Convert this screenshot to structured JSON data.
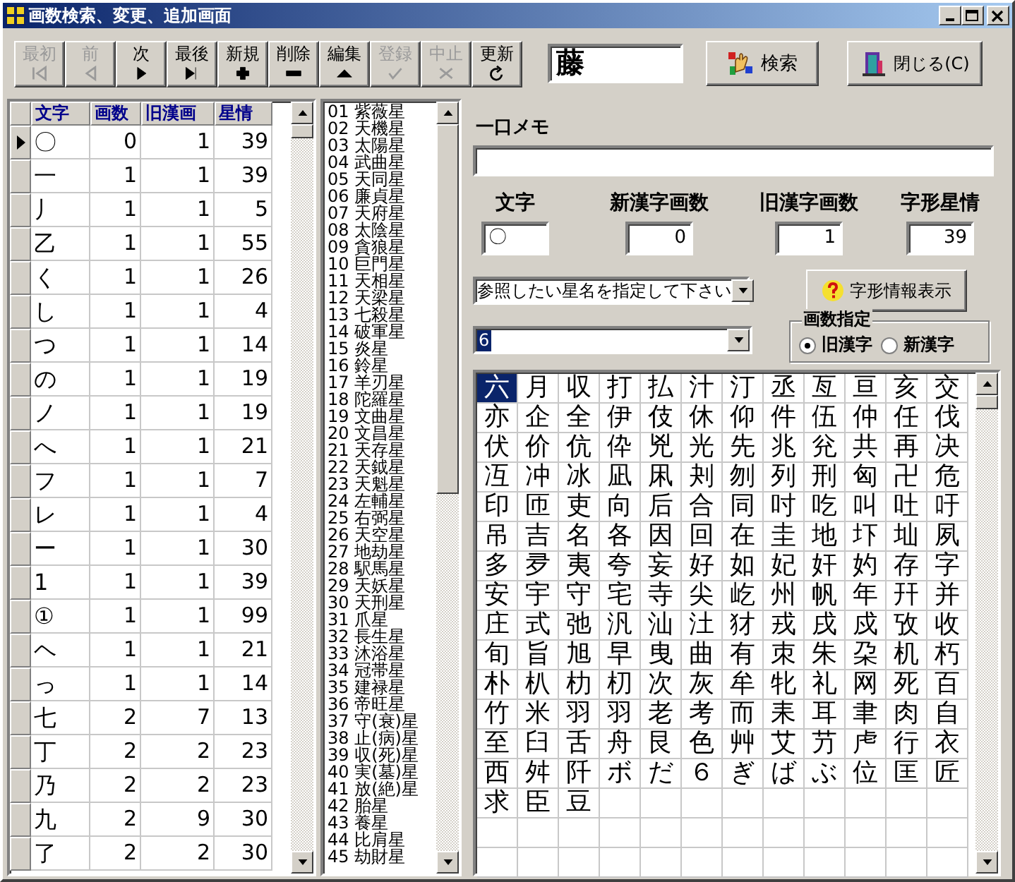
{
  "window": {
    "title": "画数検索、変更、追加画面"
  },
  "toolbar": {
    "buttons": [
      {
        "label": "最初",
        "kind": "first",
        "disabled": true
      },
      {
        "label": "前",
        "kind": "prev",
        "disabled": true
      },
      {
        "label": "次",
        "kind": "next",
        "disabled": false
      },
      {
        "label": "最後",
        "kind": "last",
        "disabled": false
      },
      {
        "label": "新規",
        "kind": "add",
        "disabled": false
      },
      {
        "label": "削除",
        "kind": "delete",
        "disabled": false
      },
      {
        "label": "編集",
        "kind": "edit",
        "disabled": false
      },
      {
        "label": "登録",
        "kind": "check",
        "disabled": true
      },
      {
        "label": "中止",
        "kind": "cancel",
        "disabled": true
      },
      {
        "label": "更新",
        "kind": "refresh",
        "disabled": false
      }
    ],
    "search_field": {
      "value": "藤"
    },
    "search_button": "検索",
    "close_button": "閉じる(C)"
  },
  "char_table": {
    "columns": [
      "文字",
      "画数",
      "旧漢画",
      "星情"
    ],
    "rows": [
      {
        "cells": [
          "〇",
          "0",
          "1",
          "39"
        ],
        "selected": true
      },
      {
        "cells": [
          "一",
          "1",
          "1",
          "39"
        ],
        "selected": false
      },
      {
        "cells": [
          "丿",
          "1",
          "1",
          "5"
        ],
        "selected": false
      },
      {
        "cells": [
          "乙",
          "1",
          "1",
          "55"
        ],
        "selected": false
      },
      {
        "cells": [
          "く",
          "1",
          "1",
          "26"
        ],
        "selected": false
      },
      {
        "cells": [
          "し",
          "1",
          "1",
          "4"
        ],
        "selected": false
      },
      {
        "cells": [
          "つ",
          "1",
          "1",
          "14"
        ],
        "selected": false
      },
      {
        "cells": [
          "の",
          "1",
          "1",
          "19"
        ],
        "selected": false
      },
      {
        "cells": [
          "ノ",
          "1",
          "1",
          "19"
        ],
        "selected": false
      },
      {
        "cells": [
          "へ",
          "1",
          "1",
          "21"
        ],
        "selected": false
      },
      {
        "cells": [
          "フ",
          "1",
          "1",
          "7"
        ],
        "selected": false
      },
      {
        "cells": [
          "レ",
          "1",
          "1",
          "4"
        ],
        "selected": false
      },
      {
        "cells": [
          "ー",
          "1",
          "1",
          "30"
        ],
        "selected": false
      },
      {
        "cells": [
          "1",
          "1",
          "1",
          "39"
        ],
        "selected": false
      },
      {
        "cells": [
          "①",
          "1",
          "1",
          "99"
        ],
        "selected": false
      },
      {
        "cells": [
          "ヘ",
          "1",
          "1",
          "21"
        ],
        "selected": false
      },
      {
        "cells": [
          "っ",
          "1",
          "1",
          "14"
        ],
        "selected": false
      },
      {
        "cells": [
          "七",
          "2",
          "7",
          "13"
        ],
        "selected": false
      },
      {
        "cells": [
          "丁",
          "2",
          "2",
          "23"
        ],
        "selected": false
      },
      {
        "cells": [
          "乃",
          "2",
          "2",
          "23"
        ],
        "selected": false
      },
      {
        "cells": [
          "九",
          "2",
          "9",
          "30"
        ],
        "selected": false
      },
      {
        "cells": [
          "了",
          "2",
          "2",
          "30"
        ],
        "selected": false
      }
    ]
  },
  "star_list": {
    "items": [
      "01 紫薇星",
      "02 天機星",
      "03 太陽星",
      "04 武曲星",
      "05 天同星",
      "06 廉貞星",
      "07 天府星",
      "08 太陰星",
      "09 貪狼星",
      "10 巨門星",
      "11 天相星",
      "12 天梁星",
      "13 七殺星",
      "14 破軍星",
      "15 炎星",
      "16 鈴星",
      "17 羊刃星",
      "18 陀羅星",
      "19 文曲星",
      "20 文昌星",
      "21 天存星",
      "22 天鉞星",
      "23 天魁星",
      "24 左輔星",
      "25 右弼星",
      "26 天空星",
      "27 地劫星",
      "28 駅馬星",
      "29 天妖星",
      "30 天刑星",
      "31 爪星",
      "32 長生星",
      "33 沐浴星",
      "34 冠帯星",
      "35 建禄星",
      "36 帝旺星",
      "37 守(衰)星",
      "38 止(病)星",
      "39 収(死)星",
      "40 実(墓)星",
      "41 放(絶)星",
      "42 胎星",
      "43 養星",
      "44 比肩星",
      "45 劫財星"
    ]
  },
  "detail": {
    "memo_label": "一口メモ",
    "fields": [
      {
        "label": "文字",
        "value": "〇",
        "kind": "text"
      },
      {
        "label": "新漢字画数",
        "value": "0",
        "kind": "number"
      },
      {
        "label": "旧漢字画数",
        "value": "1",
        "kind": "number"
      },
      {
        "label": "字形星情",
        "value": "39",
        "kind": "number"
      }
    ],
    "star_dropdown": {
      "value": "参照したい星名を指定して下さい"
    },
    "info_button": "字形情報表示",
    "count_dropdown": {
      "value": "6",
      "text_selected": true
    },
    "stroke_mode": {
      "title": "画数指定",
      "options": [
        {
          "label": "旧漢字",
          "selected": true
        },
        {
          "label": "新漢字",
          "selected": false
        }
      ]
    }
  },
  "char_grid": {
    "cells": [
      {
        "char": "六",
        "selected": true
      },
      {
        "char": "月",
        "selected": false
      },
      {
        "char": "収",
        "selected": false
      },
      {
        "char": "打",
        "selected": false
      },
      {
        "char": "払",
        "selected": false
      },
      {
        "char": "汁",
        "selected": false
      },
      {
        "char": "汀",
        "selected": false
      },
      {
        "char": "丞",
        "selected": false
      },
      {
        "char": "亙",
        "selected": false
      },
      {
        "char": "亘",
        "selected": false
      },
      {
        "char": "亥",
        "selected": false
      },
      {
        "char": "交",
        "selected": false
      },
      {
        "char": "亦",
        "selected": false
      },
      {
        "char": "企",
        "selected": false
      },
      {
        "char": "全",
        "selected": false
      },
      {
        "char": "伊",
        "selected": false
      },
      {
        "char": "伎",
        "selected": false
      },
      {
        "char": "休",
        "selected": false
      },
      {
        "char": "仰",
        "selected": false
      },
      {
        "char": "件",
        "selected": false
      },
      {
        "char": "伍",
        "selected": false
      },
      {
        "char": "仲",
        "selected": false
      },
      {
        "char": "任",
        "selected": false
      },
      {
        "char": "伐",
        "selected": false
      },
      {
        "char": "伏",
        "selected": false
      },
      {
        "char": "价",
        "selected": false
      },
      {
        "char": "伉",
        "selected": false
      },
      {
        "char": "伜",
        "selected": false
      },
      {
        "char": "兇",
        "selected": false
      },
      {
        "char": "光",
        "selected": false
      },
      {
        "char": "先",
        "selected": false
      },
      {
        "char": "兆",
        "selected": false
      },
      {
        "char": "兊",
        "selected": false
      },
      {
        "char": "共",
        "selected": false
      },
      {
        "char": "再",
        "selected": false
      },
      {
        "char": "决",
        "selected": false
      },
      {
        "char": "冱",
        "selected": false
      },
      {
        "char": "冲",
        "selected": false
      },
      {
        "char": "冰",
        "selected": false
      },
      {
        "char": "凪",
        "selected": false
      },
      {
        "char": "凩",
        "selected": false
      },
      {
        "char": "刔",
        "selected": false
      },
      {
        "char": "刎",
        "selected": false
      },
      {
        "char": "列",
        "selected": false
      },
      {
        "char": "刑",
        "selected": false
      },
      {
        "char": "匈",
        "selected": false
      },
      {
        "char": "卍",
        "selected": false
      },
      {
        "char": "危",
        "selected": false
      },
      {
        "char": "印",
        "selected": false
      },
      {
        "char": "匝",
        "selected": false
      },
      {
        "char": "吏",
        "selected": false
      },
      {
        "char": "向",
        "selected": false
      },
      {
        "char": "后",
        "selected": false
      },
      {
        "char": "合",
        "selected": false
      },
      {
        "char": "同",
        "selected": false
      },
      {
        "char": "吋",
        "selected": false
      },
      {
        "char": "吃",
        "selected": false
      },
      {
        "char": "叫",
        "selected": false
      },
      {
        "char": "吐",
        "selected": false
      },
      {
        "char": "吁",
        "selected": false
      },
      {
        "char": "吊",
        "selected": false
      },
      {
        "char": "吉",
        "selected": false
      },
      {
        "char": "名",
        "selected": false
      },
      {
        "char": "各",
        "selected": false
      },
      {
        "char": "因",
        "selected": false
      },
      {
        "char": "回",
        "selected": false
      },
      {
        "char": "在",
        "selected": false
      },
      {
        "char": "圭",
        "selected": false
      },
      {
        "char": "地",
        "selected": false
      },
      {
        "char": "圷",
        "selected": false
      },
      {
        "char": "圸",
        "selected": false
      },
      {
        "char": "夙",
        "selected": false
      },
      {
        "char": "多",
        "selected": false
      },
      {
        "char": "夛",
        "selected": false
      },
      {
        "char": "夷",
        "selected": false
      },
      {
        "char": "夸",
        "selected": false
      },
      {
        "char": "妄",
        "selected": false
      },
      {
        "char": "好",
        "selected": false
      },
      {
        "char": "如",
        "selected": false
      },
      {
        "char": "妃",
        "selected": false
      },
      {
        "char": "奸",
        "selected": false
      },
      {
        "char": "妁",
        "selected": false
      },
      {
        "char": "存",
        "selected": false
      },
      {
        "char": "字",
        "selected": false
      },
      {
        "char": "安",
        "selected": false
      },
      {
        "char": "宇",
        "selected": false
      },
      {
        "char": "守",
        "selected": false
      },
      {
        "char": "宅",
        "selected": false
      },
      {
        "char": "寺",
        "selected": false
      },
      {
        "char": "尖",
        "selected": false
      },
      {
        "char": "屹",
        "selected": false
      },
      {
        "char": "州",
        "selected": false
      },
      {
        "char": "帆",
        "selected": false
      },
      {
        "char": "年",
        "selected": false
      },
      {
        "char": "幵",
        "selected": false
      },
      {
        "char": "并",
        "selected": false
      },
      {
        "char": "庄",
        "selected": false
      },
      {
        "char": "式",
        "selected": false
      },
      {
        "char": "弛",
        "selected": false
      },
      {
        "char": "汎",
        "selected": false
      },
      {
        "char": "汕",
        "selected": false
      },
      {
        "char": "汢",
        "selected": false
      },
      {
        "char": "犲",
        "selected": false
      },
      {
        "char": "戎",
        "selected": false
      },
      {
        "char": "戌",
        "selected": false
      },
      {
        "char": "戍",
        "selected": false
      },
      {
        "char": "攷",
        "selected": false
      },
      {
        "char": "收",
        "selected": false
      },
      {
        "char": "旬",
        "selected": false
      },
      {
        "char": "旨",
        "selected": false
      },
      {
        "char": "旭",
        "selected": false
      },
      {
        "char": "早",
        "selected": false
      },
      {
        "char": "曳",
        "selected": false
      },
      {
        "char": "曲",
        "selected": false
      },
      {
        "char": "有",
        "selected": false
      },
      {
        "char": "朿",
        "selected": false
      },
      {
        "char": "朱",
        "selected": false
      },
      {
        "char": "朶",
        "selected": false
      },
      {
        "char": "机",
        "selected": false
      },
      {
        "char": "朽",
        "selected": false
      },
      {
        "char": "朴",
        "selected": false
      },
      {
        "char": "朳",
        "selected": false
      },
      {
        "char": "朸",
        "selected": false
      },
      {
        "char": "朷",
        "selected": false
      },
      {
        "char": "次",
        "selected": false
      },
      {
        "char": "灰",
        "selected": false
      },
      {
        "char": "牟",
        "selected": false
      },
      {
        "char": "牝",
        "selected": false
      },
      {
        "char": "礼",
        "selected": false
      },
      {
        "char": "网",
        "selected": false
      },
      {
        "char": "死",
        "selected": false
      },
      {
        "char": "百",
        "selected": false
      },
      {
        "char": "竹",
        "selected": false
      },
      {
        "char": "米",
        "selected": false
      },
      {
        "char": "羽",
        "selected": false
      },
      {
        "char": "羽",
        "selected": false
      },
      {
        "char": "老",
        "selected": false
      },
      {
        "char": "考",
        "selected": false
      },
      {
        "char": "而",
        "selected": false
      },
      {
        "char": "耒",
        "selected": false
      },
      {
        "char": "耳",
        "selected": false
      },
      {
        "char": "聿",
        "selected": false
      },
      {
        "char": "肉",
        "selected": false
      },
      {
        "char": "自",
        "selected": false
      },
      {
        "char": "至",
        "selected": false
      },
      {
        "char": "臼",
        "selected": false
      },
      {
        "char": "舌",
        "selected": false
      },
      {
        "char": "舟",
        "selected": false
      },
      {
        "char": "艮",
        "selected": false
      },
      {
        "char": "色",
        "selected": false
      },
      {
        "char": "艸",
        "selected": false
      },
      {
        "char": "艾",
        "selected": false
      },
      {
        "char": "芀",
        "selected": false
      },
      {
        "char": "虍",
        "selected": false
      },
      {
        "char": "行",
        "selected": false
      },
      {
        "char": "衣",
        "selected": false
      },
      {
        "char": "西",
        "selected": false
      },
      {
        "char": "舛",
        "selected": false
      },
      {
        "char": "阡",
        "selected": false
      },
      {
        "char": "ボ",
        "selected": false
      },
      {
        "char": "だ",
        "selected": false
      },
      {
        "char": "６",
        "selected": false
      },
      {
        "char": "ぎ",
        "selected": false
      },
      {
        "char": "ば",
        "selected": false
      },
      {
        "char": "ぶ",
        "selected": false
      },
      {
        "char": "位",
        "selected": false
      },
      {
        "char": "匡",
        "selected": false
      },
      {
        "char": "匠",
        "selected": false
      },
      {
        "char": "求",
        "selected": false
      },
      {
        "char": "臣",
        "selected": false
      },
      {
        "char": "豆",
        "selected": false
      }
    ]
  }
}
